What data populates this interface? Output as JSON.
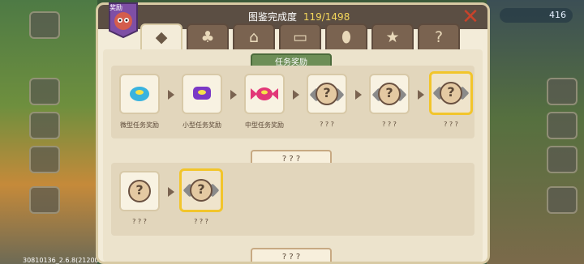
{
  "header": {
    "badge_label": "奖励",
    "title": "图鉴完成度",
    "progress": "119/1498",
    "close_icon": "close-icon"
  },
  "tabs": [
    {
      "icon": "gem-icon",
      "glyph": "◆"
    },
    {
      "icon": "clover-icon",
      "glyph": "♣"
    },
    {
      "icon": "house-icon",
      "glyph": "⌂"
    },
    {
      "icon": "chest-icon",
      "glyph": "▭"
    },
    {
      "icon": "egg-icon",
      "glyph": "⬮"
    },
    {
      "icon": "star-icon",
      "glyph": "★"
    },
    {
      "icon": "question-icon",
      "glyph": "?"
    }
  ],
  "sections": [
    {
      "title": "任务奖励",
      "items": [
        {
          "label": "微型任务奖励",
          "icon": "blue-candy-icon"
        },
        {
          "label": "小型任务奖励",
          "icon": "purple-candy-icon"
        },
        {
          "label": "中型任务奖励",
          "icon": "pink-candy-icon"
        },
        {
          "label": "? ? ?",
          "icon": "locked-reward-icon"
        },
        {
          "label": "? ? ?",
          "icon": "locked-reward-icon"
        },
        {
          "label": "? ? ?",
          "icon": "locked-reward-icon"
        }
      ]
    },
    {
      "title": "? ? ?",
      "items": [
        {
          "label": "? ? ?",
          "icon": "locked-reward-icon"
        },
        {
          "label": "? ? ?",
          "icon": "locked-reward-icon"
        }
      ]
    },
    {
      "title": "? ? ?"
    }
  ],
  "hud": {
    "counter": "416",
    "version": "30810136_2.6.8(21200000814)"
  }
}
